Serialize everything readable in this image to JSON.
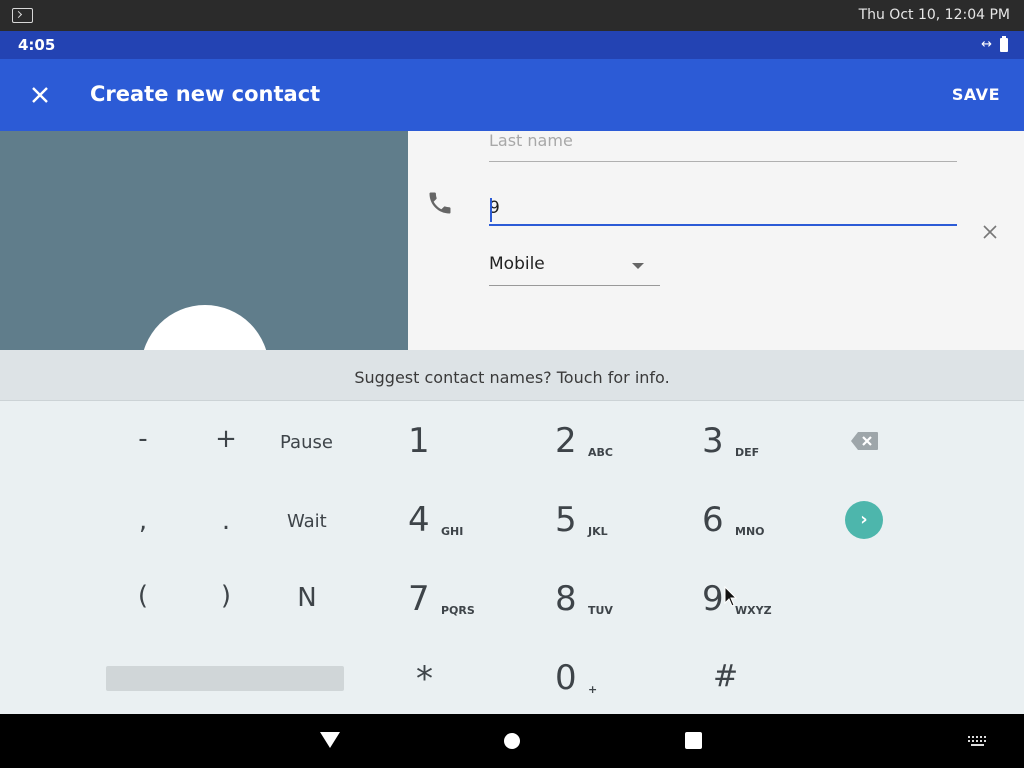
{
  "host": {
    "clock": "Thu Oct 10, 12:04 PM"
  },
  "status": {
    "time": "4:05"
  },
  "appbar": {
    "title": "Create new contact",
    "save": "SAVE"
  },
  "form": {
    "last_name_placeholder": "Last name",
    "phone_value": "9",
    "phone_type": "Mobile"
  },
  "suggestion": "Suggest contact names? Touch for info.",
  "keypad": {
    "sym_minus": "-",
    "sym_plus": "+",
    "pause": "Pause",
    "sym_comma": ",",
    "sym_dot": ".",
    "wait": "Wait",
    "sym_lparen": "(",
    "sym_rparen": ")",
    "sym_n": "N",
    "digits": [
      {
        "d": "1",
        "l": ""
      },
      {
        "d": "2",
        "l": "ABC"
      },
      {
        "d": "3",
        "l": "DEF"
      },
      {
        "d": "4",
        "l": "GHI"
      },
      {
        "d": "5",
        "l": "JKL"
      },
      {
        "d": "6",
        "l": "MNO"
      },
      {
        "d": "7",
        "l": "PQRS"
      },
      {
        "d": "8",
        "l": "TUV"
      },
      {
        "d": "9",
        "l": "WXYZ"
      },
      {
        "d": "*",
        "l": ""
      },
      {
        "d": "0",
        "l": "+"
      },
      {
        "d": "#",
        "l": ""
      }
    ]
  },
  "colors": {
    "status_bar": "#2343b3",
    "app_bar": "#2c5bd6",
    "accent_next": "#4db6ac",
    "photo_bg": "#607d8b"
  }
}
